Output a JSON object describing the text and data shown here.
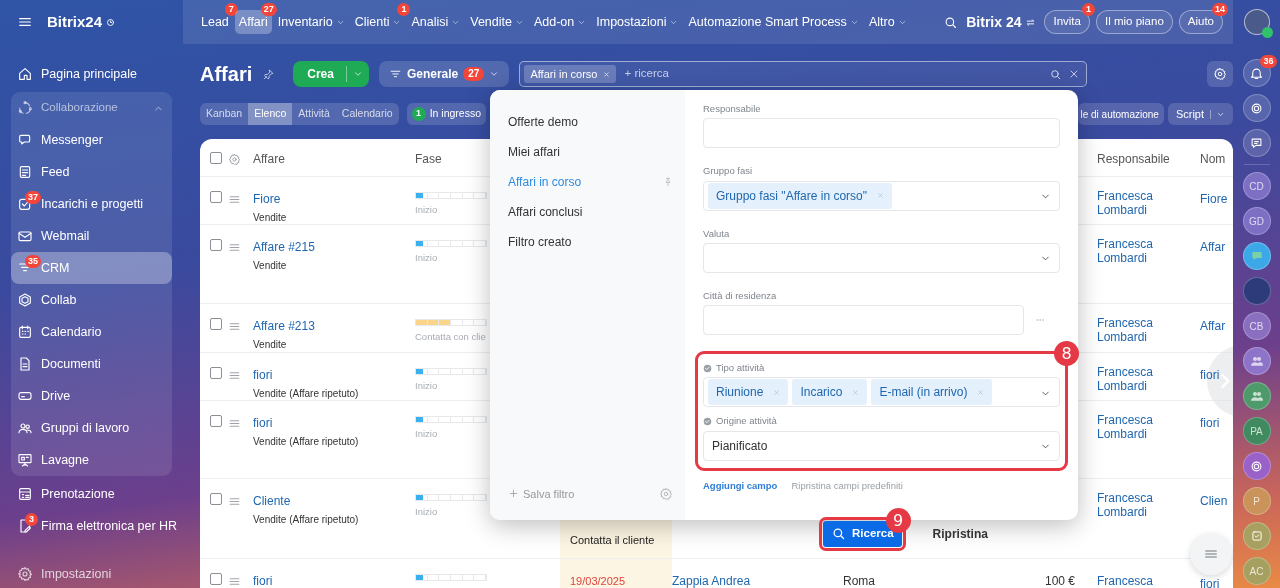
{
  "topbar": {
    "app_name": "Bitrix24",
    "nav": [
      {
        "label": "Lead",
        "counter": "7",
        "dropdown": false,
        "selected": false
      },
      {
        "label": "Affari",
        "counter": "27",
        "dropdown": false,
        "selected": true
      },
      {
        "label": "Inventario",
        "dropdown": true,
        "selected": false
      },
      {
        "label": "Clienti",
        "counter": "1",
        "dropdown": true,
        "selected": false
      },
      {
        "label": "Analisi",
        "dropdown": true,
        "selected": false
      },
      {
        "label": "Vendite",
        "dropdown": true,
        "selected": false
      },
      {
        "label": "Add-on",
        "dropdown": true,
        "selected": false
      },
      {
        "label": "Impostazioni",
        "dropdown": true,
        "selected": false
      },
      {
        "label": "Automazione Smart Process",
        "dropdown": true,
        "selected": false
      },
      {
        "label": "Altro",
        "dropdown": true,
        "selected": false
      }
    ],
    "brand": "Bitrix 24",
    "buttons": [
      {
        "label": "Invita",
        "counter": "1"
      },
      {
        "label": "Il mio piano"
      },
      {
        "label": "Aiuto",
        "counter": "14"
      }
    ]
  },
  "sidebar": {
    "items": [
      {
        "label": "Pagina principale",
        "selected": false
      },
      {
        "label": "Collaborazione",
        "expanded": true,
        "children": [
          {
            "label": "Messenger",
            "selected": false
          },
          {
            "label": "Feed",
            "selected": false
          },
          {
            "label": "Incarichi e progetti",
            "counter": "37",
            "selected": false
          },
          {
            "label": "Webmail",
            "selected": false
          },
          {
            "label": "CRM",
            "counter": "35",
            "selected": true
          },
          {
            "label": "Collab",
            "selected": false
          },
          {
            "label": "Calendario",
            "selected": false
          },
          {
            "label": "Documenti",
            "selected": false
          },
          {
            "label": "Drive",
            "selected": false
          },
          {
            "label": "Gruppi di lavoro",
            "selected": false
          },
          {
            "label": "Lavagne",
            "selected": false
          }
        ]
      },
      {
        "label": "Prenotazione",
        "selected": false
      },
      {
        "label": "Firma elettronica per HR",
        "counter": "3",
        "selected": false
      }
    ],
    "settings": "Impostazioni"
  },
  "toolbar": {
    "title": "Affari",
    "create": "Crea",
    "preset": {
      "label": "Generale",
      "counter": "27"
    },
    "search": {
      "tag": "Affari in corso",
      "placeholder": "+ ricerca"
    },
    "view_tabs": [
      {
        "label": "Kanban",
        "selected": false
      },
      {
        "label": "Elenco",
        "selected": true
      },
      {
        "label": "Attività",
        "selected": false
      },
      {
        "label": "Calendario",
        "selected": false
      }
    ],
    "incoming": {
      "count": "1",
      "label": "In ingresso"
    },
    "automation": "le di automazione",
    "script": "Script"
  },
  "table": {
    "select_all_checked": false,
    "columns": [
      {
        "label": "Affare"
      },
      {
        "label": "Fase"
      },
      {
        "label": "Responsabile"
      },
      {
        "label": "Nom"
      }
    ],
    "rows": [
      {
        "checked": false,
        "title": "Fiore",
        "pipeline": "Vendite",
        "stage": {
          "label": "Inizio",
          "level": 0.1,
          "color": "#3bb0ee"
        },
        "responsible": "Francesca Lombardi",
        "name": "Fiore"
      },
      {
        "checked": false,
        "title": "Affare #215",
        "pipeline": "Vendite",
        "stage": {
          "label": "Inizio",
          "level": 0.1,
          "color": "#3bb0ee"
        },
        "responsible": "Francesca Lombardi",
        "name": "Affar"
      },
      {
        "checked": false,
        "title": "Affare #213",
        "pipeline": "Vendite",
        "stage": {
          "label": "Contatta con clie",
          "level": 0.5,
          "color": "#fad58a"
        },
        "responsible": "Francesca Lombardi",
        "name": "Affar"
      },
      {
        "checked": false,
        "title": "fiori",
        "pipeline": "Vendite (Affare ripetuto)",
        "stage": {
          "label": "Inizio",
          "level": 0.1,
          "color": "#3bb0ee"
        },
        "responsible": "Francesca Lombardi",
        "name": "fiori"
      },
      {
        "checked": false,
        "title": "fiori",
        "pipeline": "Vendite (Affare ripetuto)",
        "stage": {
          "label": "Inizio",
          "level": 0.1,
          "color": "#3bb0ee"
        },
        "responsible": "Francesca Lombardi",
        "name": "fiori"
      },
      {
        "checked": false,
        "title": "Cliente",
        "pipeline": "Vendite (Affare ripetuto)",
        "stage": {
          "label": "Inizio",
          "level": 0.1,
          "color": "#3bb0ee"
        },
        "activity": {
          "text": "Contatta il cliente",
          "overdue": false
        },
        "responsible": "Francesca Lombardi",
        "name": "Clien"
      },
      {
        "checked": false,
        "title": "fiori",
        "stage": {
          "level": 0.1,
          "color": "#3bb0ee"
        },
        "activity": {
          "text": "19/03/2025",
          "overdue": true
        },
        "contact": "Zappia Andrea",
        "city": "Roma",
        "sum": "100 €",
        "responsible": "Francesca",
        "name": "fiori"
      }
    ]
  },
  "filter_popup": {
    "presets": [
      {
        "label": "Offerte demo",
        "selected": false
      },
      {
        "label": "Miei affari",
        "selected": false
      },
      {
        "label": "Affari in corso",
        "selected": true
      },
      {
        "label": "Affari conclusi",
        "selected": false
      },
      {
        "label": "Filtro creato",
        "selected": false
      }
    ],
    "save": "Salva filtro",
    "fields": [
      {
        "kind": "input",
        "label": "Responsabile"
      },
      {
        "kind": "tags",
        "label": "Gruppo fasi",
        "tags": [
          "Gruppo fasi \"Affare in corso\""
        ]
      },
      {
        "kind": "select",
        "label": "Valuta"
      },
      {
        "kind": "input",
        "label": "Città di residenza",
        "more": true
      }
    ],
    "highlight": {
      "marker": "8",
      "fields": [
        {
          "kind": "tags",
          "label": "Tipo attività",
          "tags": [
            "Riunione",
            "Incarico",
            "E-mail (in arrivo)"
          ]
        },
        {
          "kind": "select",
          "label": "Origine attività",
          "value": "Pianificato"
        }
      ]
    },
    "add_field": "Aggiungi campo",
    "reset_fields": "Ripristina campi predefiniti",
    "search_button": {
      "label": "Ricerca",
      "marker": "9"
    },
    "reset_button": "Ripristina"
  },
  "rail": [
    {
      "kind": "bell",
      "counter": "36"
    },
    {
      "kind": "icon"
    },
    {
      "kind": "chat"
    },
    {
      "kind": "divider"
    },
    {
      "kind": "initials",
      "label": "CD",
      "color": "#7d6fc4"
    },
    {
      "kind": "initials",
      "label": "GD",
      "color": "#7d6fc4"
    },
    {
      "kind": "chat-avatar",
      "color": "#3ca8e8"
    },
    {
      "kind": "photo",
      "color": "#2d3b7a"
    },
    {
      "kind": "initials",
      "label": "CB",
      "color": "#8a6ec0"
    },
    {
      "kind": "group",
      "color": "#8d74c8"
    },
    {
      "kind": "group",
      "color": "#4f9a6a"
    },
    {
      "kind": "initials",
      "label": "PA",
      "color": "#3f8a5e"
    },
    {
      "kind": "icon",
      "color": "#9a62c8"
    },
    {
      "kind": "initials",
      "label": "P",
      "color": "#c9935a"
    },
    {
      "kind": "task",
      "color": "#a8a060"
    },
    {
      "kind": "initials",
      "label": "AC",
      "color": "#a6a060"
    }
  ]
}
